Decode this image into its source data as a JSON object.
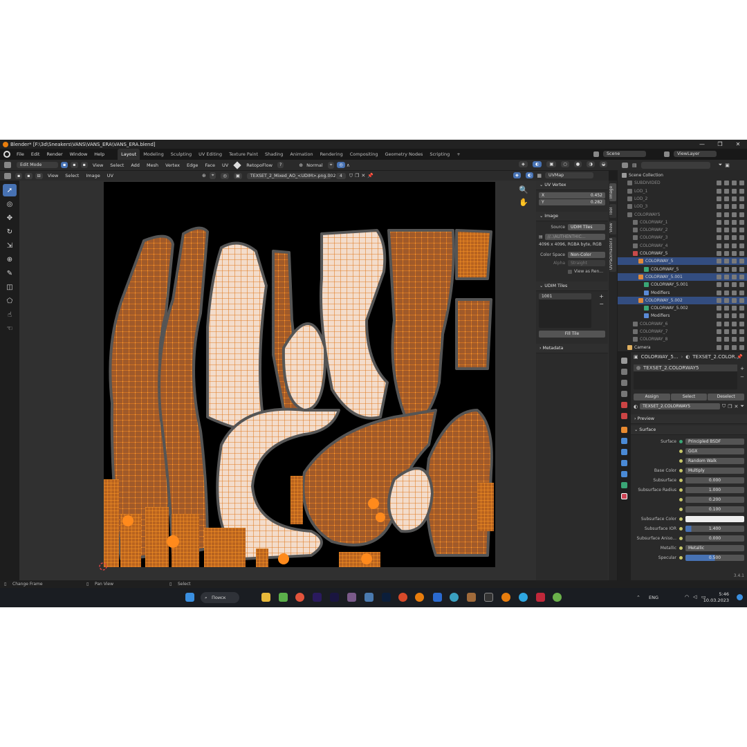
{
  "window": {
    "title": "Blender* [F:\\3d\\Sneakers\\VANS\\VANS_ERA\\VANS_ERA.blend]",
    "controls": [
      "—",
      "❐",
      "✕"
    ]
  },
  "menu": [
    "File",
    "Edit",
    "Render",
    "Window",
    "Help"
  ],
  "workspaces": [
    "Layout",
    "Modeling",
    "Sculpting",
    "UV Editing",
    "Texture Paint",
    "Shading",
    "Animation",
    "Rendering",
    "Compositing",
    "Geometry Nodes",
    "Scripting"
  ],
  "scene": {
    "name": "Scene",
    "view_layer": "ViewLayer"
  },
  "toolbar": {
    "mode": "Edit Mode",
    "items": [
      "View",
      "Select",
      "Add",
      "Mesh",
      "Vertex",
      "Edge",
      "Face",
      "UV"
    ],
    "addon": "RetopoFlow",
    "orientation": "Normal"
  },
  "uv_header": {
    "items": [
      "View",
      "Select",
      "Image",
      "UV"
    ],
    "image_name": "TEXSET_2_Mixed_AO_<UDIM>.png.002",
    "users": "4",
    "uvmap": "UVMap"
  },
  "npanel": {
    "uv_vertex": {
      "title": "UV Vertex",
      "x_label": "X",
      "x": "0.452",
      "y_label": "Y",
      "y": "0.282"
    },
    "image": {
      "title": "Image",
      "source_label": "Source",
      "source": "UDIM Tiles",
      "path": "//..\\AUTHENTHIC...",
      "info": "4096 x 4096,  RGBA byte,  RGB",
      "colorspace_label": "Color Space",
      "colorspace": "Non-Color",
      "alpha_label": "Alpha",
      "alpha": "Straight",
      "view_as_render": "View as Ren..."
    },
    "udim": {
      "title": "UDIM Tiles",
      "tile": "1001",
      "fill": "Fill Tile"
    },
    "metadata": {
      "title": "Metadata"
    }
  },
  "side_tabs": [
    "Image",
    "Tool",
    "View",
    "UVPackmaster3"
  ],
  "outliner": {
    "search_placeholder": "",
    "rows": [
      {
        "label": "Scene Collection",
        "indent": 0,
        "dim": false,
        "sel": false,
        "icon": "#9a9a9a"
      },
      {
        "label": "SUBDIVIDED",
        "indent": 1,
        "dim": true,
        "sel": false,
        "icon": "#6e6e6e"
      },
      {
        "label": "LOD_1",
        "indent": 1,
        "dim": true,
        "sel": false,
        "icon": "#6e6e6e"
      },
      {
        "label": "LOD_2",
        "indent": 1,
        "dim": true,
        "sel": false,
        "icon": "#6e6e6e"
      },
      {
        "label": "LOD_3",
        "indent": 1,
        "dim": true,
        "sel": false,
        "icon": "#6e6e6e"
      },
      {
        "label": "COLORWAYS",
        "indent": 1,
        "dim": true,
        "sel": false,
        "icon": "#6e6e6e"
      },
      {
        "label": "COLORWAY_1",
        "indent": 2,
        "dim": true,
        "sel": false,
        "icon": "#6e6e6e"
      },
      {
        "label": "COLORWAY_2",
        "indent": 2,
        "dim": true,
        "sel": false,
        "icon": "#6e6e6e"
      },
      {
        "label": "COLORWAY_3",
        "indent": 2,
        "dim": true,
        "sel": false,
        "icon": "#6e6e6e"
      },
      {
        "label": "COLORWAY_4",
        "indent": 2,
        "dim": true,
        "sel": false,
        "icon": "#6e6e6e"
      },
      {
        "label": "COLORWAY_5",
        "indent": 2,
        "dim": false,
        "sel": false,
        "icon": "#c84a4a"
      },
      {
        "label": "COLORWAY_5",
        "indent": 3,
        "dim": false,
        "sel": true,
        "icon": "#e08a3a"
      },
      {
        "label": "COLORWAY_5",
        "indent": 4,
        "dim": false,
        "sel": false,
        "icon": "#3aa676"
      },
      {
        "label": "COLORWAY_5.001",
        "indent": 3,
        "dim": false,
        "sel": true,
        "icon": "#e08a3a"
      },
      {
        "label": "COLORWAY_5.001",
        "indent": 4,
        "dim": false,
        "sel": false,
        "icon": "#3aa676"
      },
      {
        "label": "Modifiers",
        "indent": 4,
        "dim": false,
        "sel": false,
        "icon": "#5a8ad6"
      },
      {
        "label": "COLORWAY_5.002",
        "indent": 3,
        "dim": false,
        "sel": true,
        "icon": "#e08a3a"
      },
      {
        "label": "COLORWAY_5.002",
        "indent": 4,
        "dim": false,
        "sel": false,
        "icon": "#3aa676"
      },
      {
        "label": "Modifiers",
        "indent": 4,
        "dim": false,
        "sel": false,
        "icon": "#5a8ad6"
      },
      {
        "label": "COLORWAY_6",
        "indent": 2,
        "dim": true,
        "sel": false,
        "icon": "#6e6e6e"
      },
      {
        "label": "COLORWAY_7",
        "indent": 2,
        "dim": true,
        "sel": false,
        "icon": "#6e6e6e"
      },
      {
        "label": "COLORWAY_8",
        "indent": 2,
        "dim": true,
        "sel": false,
        "icon": "#6e6e6e"
      },
      {
        "label": "Camera",
        "indent": 1,
        "dim": false,
        "sel": false,
        "icon": "#e0b060"
      }
    ]
  },
  "properties": {
    "breadcrumb_obj": "COLORWAY_5...",
    "breadcrumb_mat": "TEXSET_2.COLOR...",
    "slot": "TEXSET_2.COLORWAY5",
    "assign": "Assign",
    "select": "Select",
    "deselect": "Deselect",
    "material": "TEXSET_2.COLORWAY5",
    "preview": "Preview",
    "surface_section": "Surface",
    "fields": [
      {
        "label": "Surface",
        "value": "Principled BSDF"
      },
      {
        "label": "",
        "value": "GGX"
      },
      {
        "label": "",
        "value": "Random Walk"
      },
      {
        "label": "Base Color",
        "value": "Multiply"
      },
      {
        "label": "Subsurface",
        "value": "0.000"
      },
      {
        "label": "Subsurface Radius",
        "value": "1.000"
      },
      {
        "label": "",
        "value": "0.200"
      },
      {
        "label": "",
        "value": "0.100"
      },
      {
        "label": "Subsurface Color",
        "value": ""
      },
      {
        "label": "Subsurface IOR",
        "value": "1.400"
      },
      {
        "label": "Subsurface Aniso...",
        "value": "0.000"
      },
      {
        "label": "Metallic",
        "value": "Metallic"
      },
      {
        "label": "Specular",
        "value": "0.500"
      }
    ],
    "version": "3.4.1"
  },
  "status": {
    "left": "Change Frame",
    "middle": "Pan View",
    "right": "Select"
  },
  "taskbar": {
    "search": "Поиск",
    "lang": "ENG",
    "time": "5:46",
    "date": "10.03.2023"
  }
}
